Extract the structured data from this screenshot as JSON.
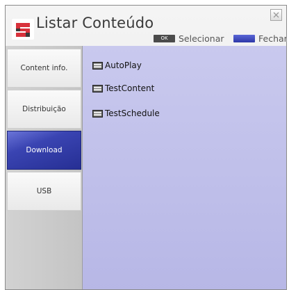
{
  "window": {
    "title": "Listar Conteúdo"
  },
  "legend": {
    "ok_badge": "OK",
    "select_label": "Selecionar",
    "close_label": "Fechar",
    "close_color": "#2d37a8"
  },
  "sidebar": {
    "tabs": [
      {
        "label": "Content info.",
        "selected": false
      },
      {
        "label": "Distribuição",
        "selected": false
      },
      {
        "label": "Download",
        "selected": true
      },
      {
        "label": "USB",
        "selected": false
      }
    ]
  },
  "content": {
    "items": [
      {
        "name": "AutoPlay",
        "icon": "folder-icon"
      },
      {
        "name": "TestContent",
        "icon": "folder-icon"
      },
      {
        "name": "TestSchedule",
        "icon": "folder-icon"
      }
    ]
  },
  "colors": {
    "accent": "#262f94",
    "content_background": "#c2c2ec",
    "brand_red": "#d8323c"
  }
}
